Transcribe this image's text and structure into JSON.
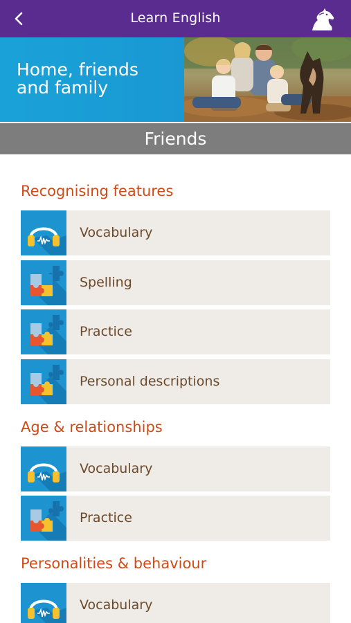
{
  "header": {
    "title": "Learn English",
    "back_icon": "chevron-left-icon",
    "logo_icon": "horse-head-logo"
  },
  "banner": {
    "title_line1": "Home, friends",
    "title_line2": "and family",
    "photo": "family-photo"
  },
  "section": {
    "title": "Friends"
  },
  "groups": [
    {
      "heading": "Recognising features",
      "items": [
        {
          "label": "Vocabulary",
          "icon": "headphones-icon"
        },
        {
          "label": "Spelling",
          "icon": "puzzle-icon"
        },
        {
          "label": "Practice",
          "icon": "puzzle-icon"
        },
        {
          "label": "Personal descriptions",
          "icon": "puzzle-icon"
        }
      ]
    },
    {
      "heading": "Age & relationships",
      "items": [
        {
          "label": "Vocabulary",
          "icon": "headphones-icon"
        },
        {
          "label": "Practice",
          "icon": "puzzle-icon"
        }
      ]
    },
    {
      "heading": "Personalities & behaviour",
      "items": [
        {
          "label": "Vocabulary",
          "icon": "headphones-icon"
        }
      ]
    }
  ],
  "colors": {
    "header_bg": "#5b2c8f",
    "banner_bg": "#1b8fcf",
    "section_bar_bg": "#7d7d7d",
    "heading_text": "#d04a17",
    "row_bg": "#efebe7",
    "row_text": "#6b4a2b",
    "icon_tile_bg": "#1d94cf"
  }
}
